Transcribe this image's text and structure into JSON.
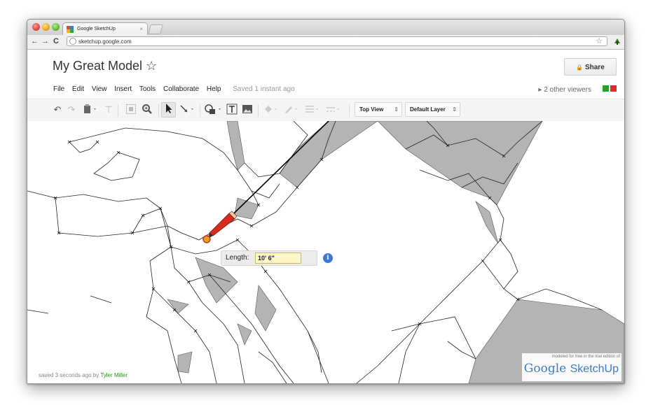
{
  "browser": {
    "tab_title": "Google SketchUp",
    "tab_close": "×",
    "url": "sketchup.google.com",
    "back": "←",
    "forward": "→",
    "reload": "C",
    "star": "☆"
  },
  "header": {
    "model_title": "My Great Model ☆",
    "share_label": "Share",
    "share_icon": "🔒"
  },
  "menu": {
    "items": [
      "File",
      "Edit",
      "View",
      "Insert",
      "Tools",
      "Collaborate",
      "Help"
    ],
    "saved_status": "Saved 1 instant ago"
  },
  "viewers": {
    "label": "▸ 2 other viewers",
    "colors": [
      "#1fa52a",
      "#e02a2a"
    ]
  },
  "toolbar": {
    "view_select": "Top View",
    "layer_select": "Default Layer",
    "select_arrow": "⇕"
  },
  "canvas": {
    "length_label": "Length:",
    "length_value": "10' 6\"",
    "info_glyph": "i"
  },
  "footer": {
    "saved_prefix": "saved 3 seconds ago by ",
    "author": "Tyler Miller"
  },
  "watermark": {
    "small_text": "modeled for free in the trial edition of",
    "google": "Google",
    "sketchup": "SketchUp"
  }
}
